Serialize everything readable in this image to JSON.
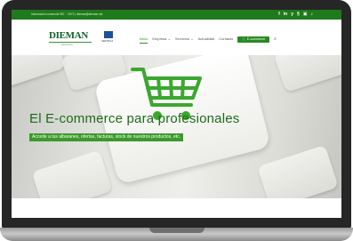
{
  "topbar": {
    "contact": "Información comercial 987 ·· 2572 | dieman@dieman.net",
    "social_icons": [
      "facebook-icon",
      "linkedin-icon",
      "twitter-icon",
      "pinterest-icon",
      "instagram-icon",
      "tiktok-icon"
    ],
    "social_glyphs": [
      "f",
      "in",
      "y",
      "§",
      "▣",
      "♪"
    ]
  },
  "header": {
    "logo_text": "DIEMAN",
    "logo_sub": "electrónica",
    "cert_text": "CERTIFICA"
  },
  "nav": {
    "items": [
      "Inicio",
      "Empresa",
      "Servicios",
      "Actualidad",
      "Contacto"
    ],
    "cta": "E-commerce",
    "search_glyph": "⌕"
  },
  "hero": {
    "title": "El E-commerce para profesionales",
    "subtitle": "Accede a tus albaranes, ofertas, facturas, stock de nuestros productos, etc."
  },
  "colors": {
    "brand_green": "#2a8a22",
    "topbar_green": "#1f7a1c",
    "title_green": "#1f6b1a"
  }
}
